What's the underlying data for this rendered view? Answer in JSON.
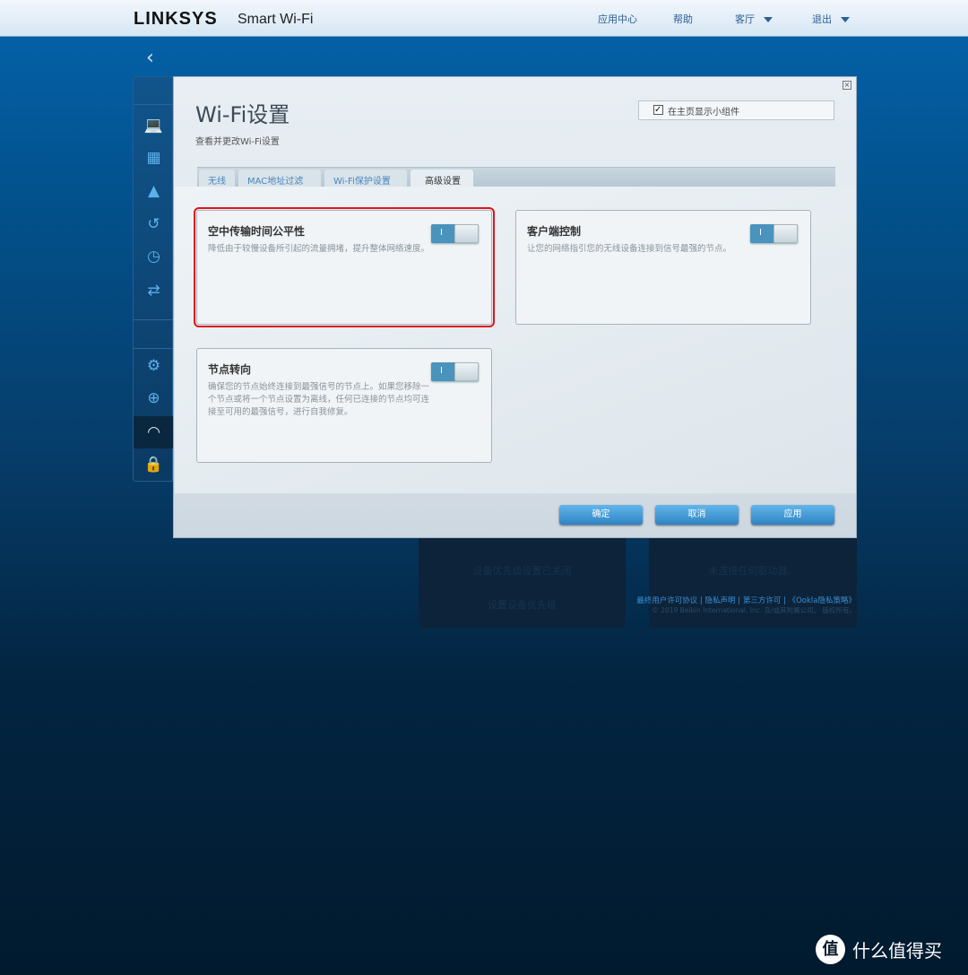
{
  "header": {
    "brand": "LINKSYS",
    "product": "Smart Wi-Fi",
    "nav": [
      "应用中心",
      "帮助",
      "客厅",
      "退出"
    ]
  },
  "sidebar": {
    "icons": [
      "devices-icon",
      "guest-access-icon",
      "parental-controls-icon",
      "media-prioritization-icon",
      "speed-test-icon",
      "external-storage-icon",
      "connectivity-icon",
      "troubleshooting-icon",
      "wifi-settings-icon",
      "security-icon"
    ],
    "selected": "wifi-settings-icon"
  },
  "background": {
    "card1_line1": "设备优先级设置已关闭",
    "card1_line2": "设置设备优先级",
    "card2_line1": "未连接任何驱动器。",
    "links": [
      "最终用户许可协议",
      "隐私声明",
      "第三方许可",
      "《Ookla隐私策略》"
    ],
    "copyright": "© 2019 Belkin International, Inc. 及/或其附属公司。 版权所有。"
  },
  "modal": {
    "title": "Wi-Fi设置",
    "subtitle": "查看并更改Wi-Fi设置",
    "widget_label": "在主页显示小组件",
    "widget_checked": true,
    "tabs": [
      "无线",
      "MAC地址过滤",
      "Wi-Fi保护设置",
      "高级设置"
    ],
    "active_tab": "高级设置",
    "cards": [
      {
        "title": "空中传输时间公平性",
        "desc": "降低由于较慢设备所引起的流量拥堵，提升整体网络速度。",
        "toggle_label": "I",
        "enabled": true
      },
      {
        "title": "客户端控制",
        "desc": "让您的网络指引您的无线设备连接到信号最强的节点。",
        "toggle_label": "I",
        "enabled": true
      },
      {
        "title": "节点转向",
        "desc": "确保您的节点始终连接到最强信号的节点上。如果您移除一个节点或将一个节点设置为离线，任何已连接的节点均可连接至可用的最强信号，进行自我修复。",
        "toggle_label": "I",
        "enabled": true
      }
    ],
    "buttons": {
      "ok": "确定",
      "cancel": "取消",
      "apply": "应用"
    }
  },
  "highlight_color": "#e0141a",
  "watermark": {
    "logo": "值",
    "text": "什么值得买"
  }
}
